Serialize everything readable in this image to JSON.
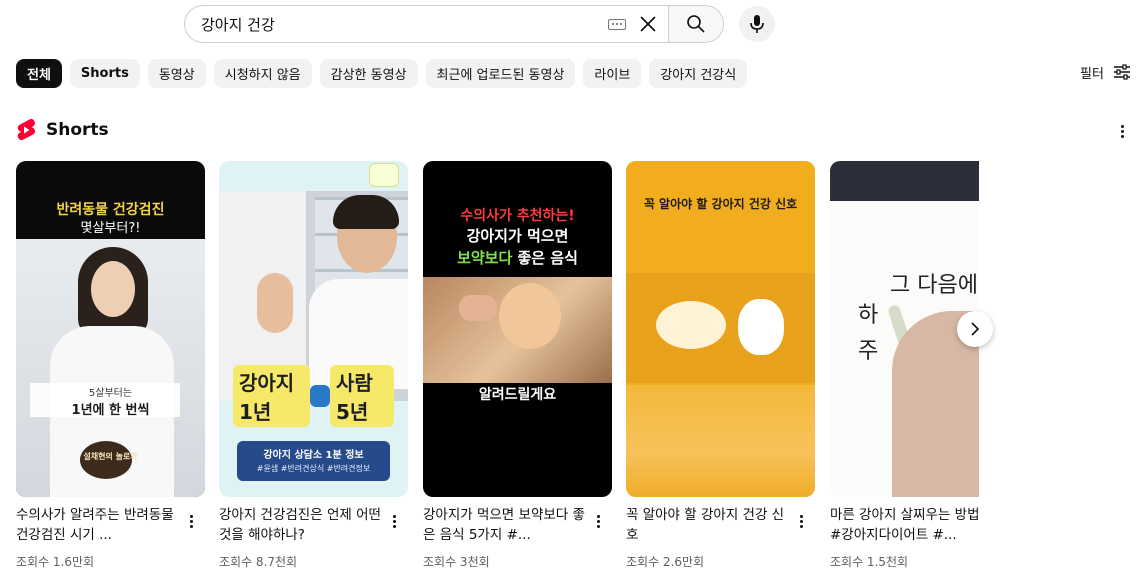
{
  "search": {
    "query": "강아지 건강"
  },
  "chips": [
    {
      "label": "전체",
      "active": true
    },
    {
      "label": "Shorts",
      "active": false
    },
    {
      "label": "동영상",
      "active": false
    },
    {
      "label": "시청하지 않음",
      "active": false
    },
    {
      "label": "감상한 동영상",
      "active": false
    },
    {
      "label": "최근에 업로드된 동영상",
      "active": false
    },
    {
      "label": "라이브",
      "active": false
    },
    {
      "label": "강아지 건강식",
      "active": false
    }
  ],
  "filter": {
    "label": "필터"
  },
  "shorts": {
    "title": "Shorts",
    "items": [
      {
        "title": "수의사가 알려주는 반려동물 건강검진 시기 ...",
        "views": "조회수 1.6만회",
        "thumb": {
          "line1": "반려동물 건강검진",
          "line2": "몇살부터?!",
          "caption_a": "5살부터는",
          "caption_b": "1년에 한 번씩",
          "badge": "설채현의 놀로와"
        }
      },
      {
        "title": "강아지 건강검진은 언제 어떤것을 해야하나?",
        "views": "조회수 8.7천회",
        "thumb": {
          "left": "강아지 1년",
          "right": "사람 5년",
          "info_title": "강아지 상담소 1분 정보",
          "info_tags": "#윤샘 #반려견상식 #반려견정보"
        }
      },
      {
        "title": "강아지가 먹으면 보약보다 좋은 음식 5가지 #...",
        "views": "조회수 3천회",
        "thumb": {
          "line1": "수의사가 추천하는!",
          "line2": "강아지가 먹으면",
          "line3_a": "보약보다",
          "line3_b": "좋은 음식",
          "bottom": "알려드릴게요"
        }
      },
      {
        "title": "꼭 알아야 할 강아지 건강 신호",
        "views": "조회수 2.6만회",
        "thumb": {
          "line1": "꼭 알아야 할 강아지 건강 신호"
        }
      },
      {
        "title": "마른 강아지 살찌우는 방법 #강아지다이어트 #...",
        "views": "조회수 1.5천회",
        "thumb": {
          "hand_line1": "그 다음에",
          "hand_line2": "하",
          "hand_line3": "주"
        }
      }
    ]
  },
  "colors": {
    "chip_active_bg": "#0f0f0f",
    "chip_bg": "#f2f2f2",
    "shorts_red": "#ff0033",
    "secondary_text": "#606060"
  },
  "icons": {
    "keyboard": "keyboard-icon",
    "clear": "close-icon",
    "search": "search-icon",
    "mic": "mic-icon",
    "filter": "filter-icon",
    "shorts": "shorts-logo-icon",
    "more": "more-vert-icon",
    "next": "chevron-right-icon"
  }
}
